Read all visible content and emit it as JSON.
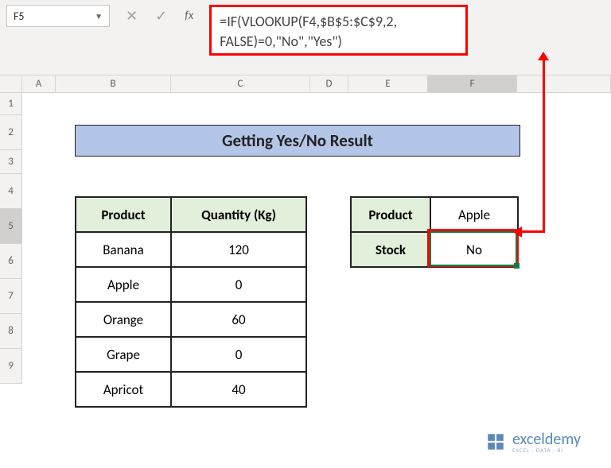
{
  "namebox": {
    "ref": "F5"
  },
  "formula": "=IF(VLOOKUP(F4,$B$5:$C$9,2,\nFALSE)=0,\"No\",\"Yes\")",
  "cols": {
    "blank": {
      "w": 28
    },
    "A": {
      "w": 42
    },
    "B": {
      "w": 120
    },
    "C": {
      "w": 170
    },
    "D": {
      "w": 52
    },
    "E": {
      "w": 100
    },
    "F": {
      "w": 110
    }
  },
  "rows": [
    "1",
    "2",
    "3",
    "4",
    "5",
    "6",
    "7",
    "8",
    "9"
  ],
  "title": "Getting Yes/No Result",
  "table1": {
    "headers": [
      "Product",
      "Quantity (Kg)"
    ],
    "rows": [
      [
        "Banana",
        "120"
      ],
      [
        "Apple",
        "0"
      ],
      [
        "Orange",
        "60"
      ],
      [
        "Grape",
        "0"
      ],
      [
        "Apricot",
        "40"
      ]
    ]
  },
  "table2": {
    "rows": [
      {
        "label": "Product",
        "value": "Apple"
      },
      {
        "label": "Stock",
        "value": "No"
      }
    ]
  },
  "logo": {
    "text": "exceldemy",
    "sub": "EXCEL · DATA · BI"
  }
}
